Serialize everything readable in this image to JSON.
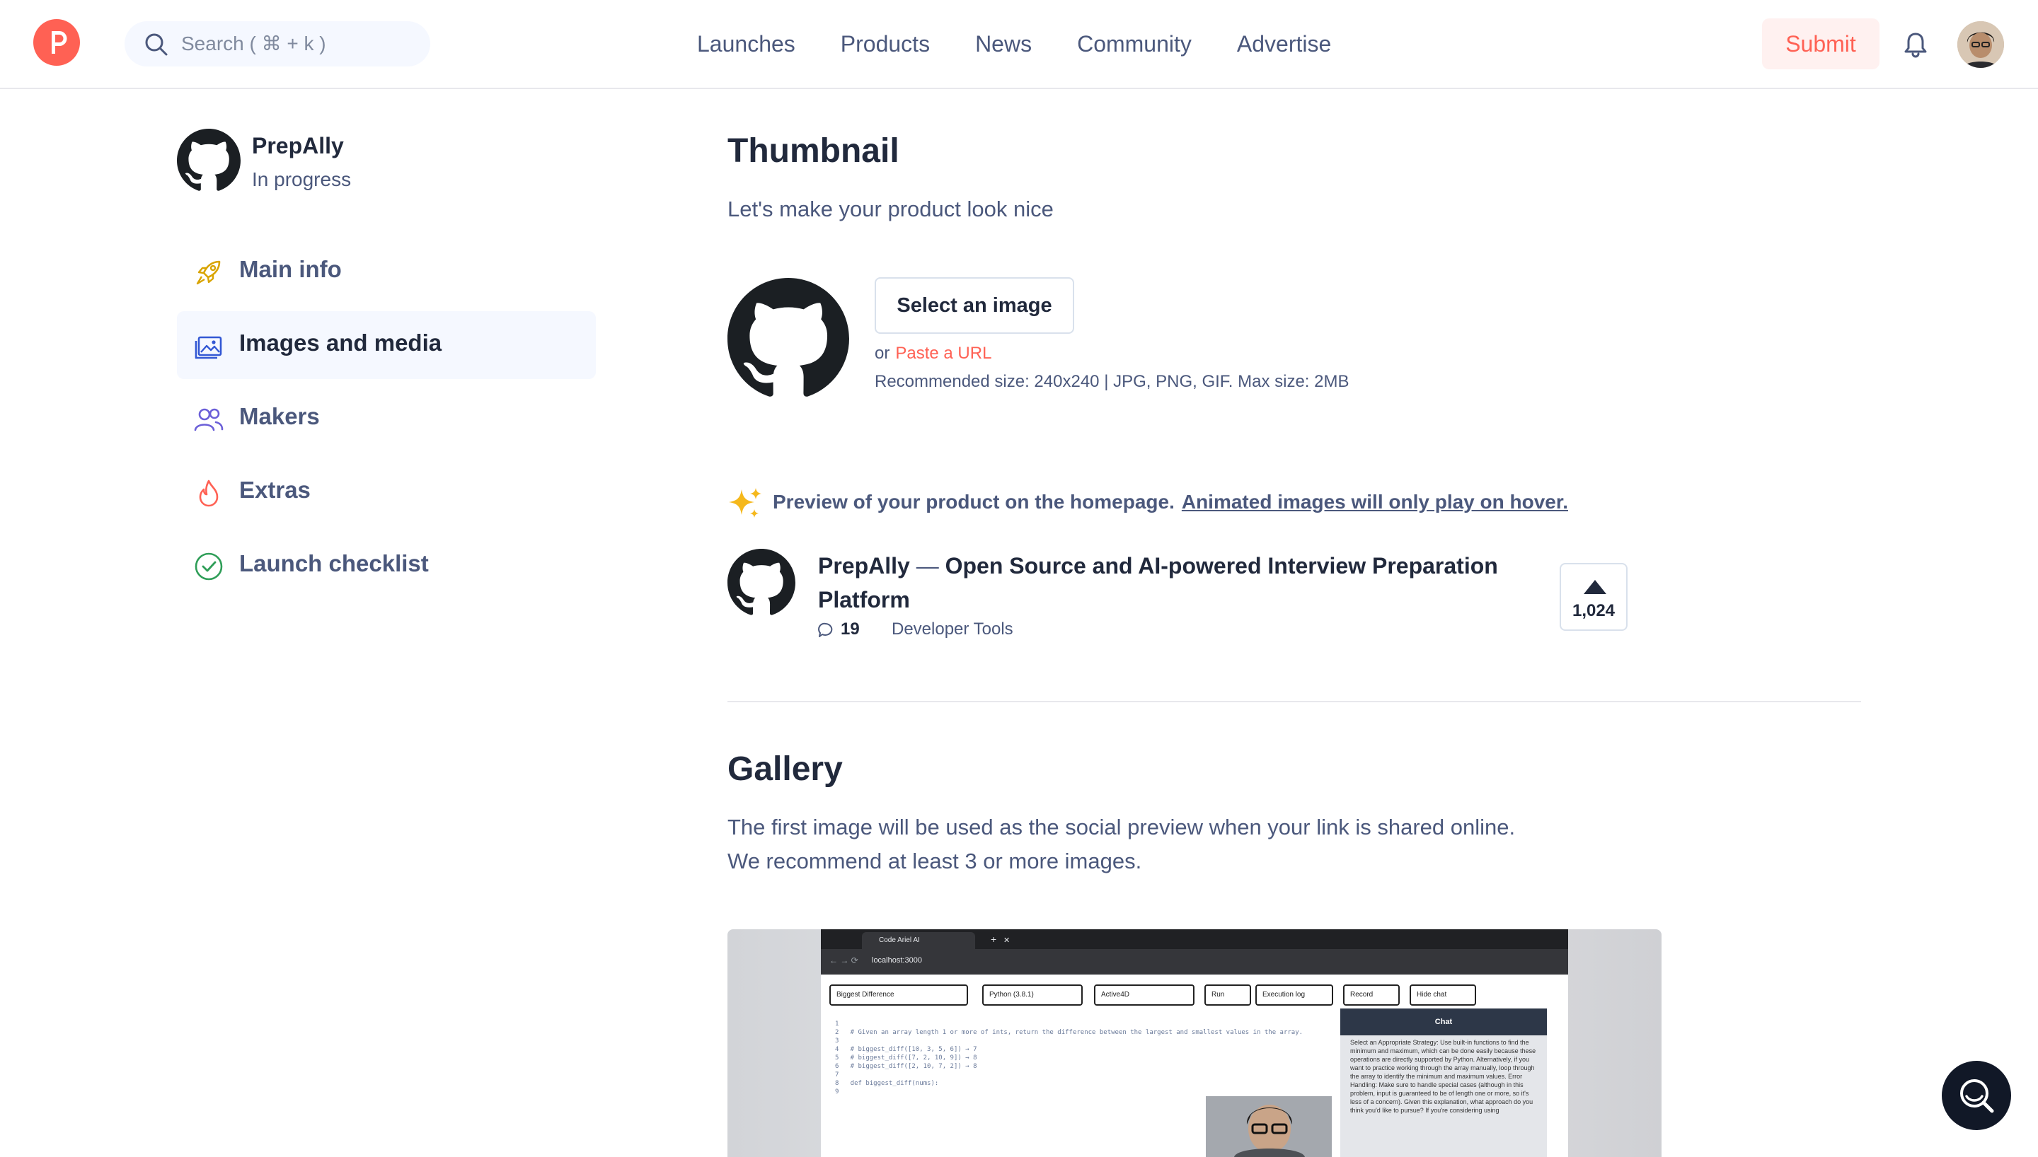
{
  "header": {
    "search_placeholder": "Search ( ⌘ + k )",
    "nav": [
      "Launches",
      "Products",
      "News",
      "Community",
      "Advertise"
    ],
    "submit_label": "Submit"
  },
  "sidebar": {
    "product_name": "PrepAlly",
    "product_status": "In progress",
    "items": [
      {
        "label": "Main info",
        "icon": "rocket-icon",
        "active": false
      },
      {
        "label": "Images and media",
        "icon": "image-icon",
        "active": true
      },
      {
        "label": "Makers",
        "icon": "users-icon",
        "active": false
      },
      {
        "label": "Extras",
        "icon": "flame-icon",
        "active": false
      },
      {
        "label": "Launch checklist",
        "icon": "check-circle-icon",
        "active": false
      }
    ]
  },
  "thumbnail": {
    "title": "Thumbnail",
    "subtitle": "Let's make your product look nice",
    "select_label": "Select an image",
    "or_text": "or",
    "paste_url": "Paste a URL",
    "recommended": "Recommended size: 240x240 | JPG, PNG, GIF. Max size: 2MB"
  },
  "preview": {
    "text": "Preview of your product on the homepage.",
    "link": "Animated images will only play on hover.",
    "card": {
      "name": "PrepAlly",
      "separator": "—",
      "tagline": "Open Source and AI-powered Interview Preparation Platform",
      "comments": "19",
      "topic": "Developer Tools",
      "upvotes": "1,024"
    }
  },
  "gallery": {
    "title": "Gallery",
    "line1": "The first image will be used as the social preview when your link is shared online.",
    "line2": "We recommend at least 3 or more images.",
    "screenshot": {
      "tab_title": "Code Ariel AI",
      "url": "localhost:3000",
      "toolbar": [
        "Biggest Difference",
        "Python (3.8.1)",
        "Active4D",
        "Run",
        "Execution log",
        "Record",
        "Hide chat"
      ],
      "code_lines": [
        "1",
        "2   # Given an array length 1 or more of ints, return the difference between the largest and smallest values in the array.",
        "3",
        "4   # biggest_diff([10, 3, 5, 6]) → 7",
        "5   # biggest_diff([7, 2, 10, 9]) → 8",
        "6   # biggest_diff([2, 10, 7, 2]) → 8",
        "7",
        "8   def biggest_diff(nums):",
        "9"
      ],
      "chat_title": "Chat",
      "chat_text": "Select an Appropriate Strategy: Use built-in functions to find the minimum and maximum, which can be done easily because these operations are directly supported by Python. Alternatively, if you want to practice working through the array manually, loop through the array to identify the minimum and maximum values. Error Handling: Make sure to handle special cases (although in this problem, input is guaranteed to be of length one or more, so it's less of a concern). Given this explanation, what approach do you think you'd like to pursue? If you're considering using"
    }
  },
  "colors": {
    "brand": "#ff6154",
    "text_primary": "#21293c",
    "text_secondary": "#4b587c",
    "active_bg": "#f5f8ff"
  }
}
